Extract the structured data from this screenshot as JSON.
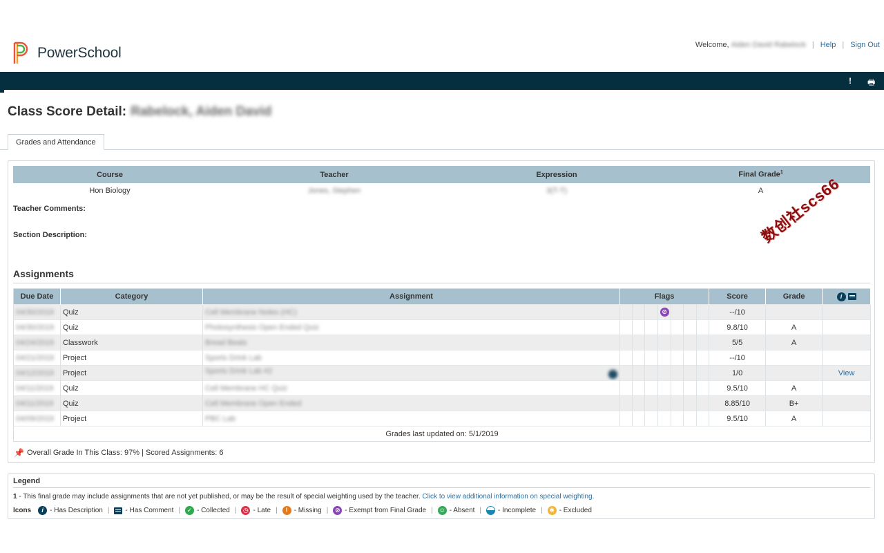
{
  "app": {
    "name": "PowerSchool"
  },
  "header": {
    "welcome_label": "Welcome,",
    "user_name": "Aiden David Rabelock",
    "help_label": "Help",
    "signout_label": "Sign Out",
    "alert_icon_glyph": "!",
    "print_icon_glyph": "🖶"
  },
  "page": {
    "title": "Class Score Detail:",
    "student_name": "Rabelock, Aiden David"
  },
  "tabs": [
    {
      "label": "Grades and Attendance"
    }
  ],
  "course": {
    "headers": {
      "course": "Course",
      "teacher": "Teacher",
      "expression": "Expression",
      "final_grade": "Final Grade",
      "final_grade_sup": "1"
    },
    "row": {
      "course": "Hon Biology",
      "teacher": "Jones, Stephen",
      "expression": "3(T-T)",
      "final_grade": "A"
    },
    "teacher_comments_label": "Teacher Comments:",
    "section_description_label": "Section Description:"
  },
  "watermark": "数创社scs66",
  "assignments": {
    "heading": "Assignments",
    "headers": {
      "due_date": "Due Date",
      "category": "Category",
      "assignment": "Assignment",
      "flags": "Flags",
      "score": "Score",
      "grade": "Grade"
    },
    "rows": [
      {
        "due_date": "04/30/2019",
        "category": "Quiz",
        "assignment": "Cell Membrane Notes (HC)",
        "score": "--/10",
        "grade": "",
        "action": ""
      },
      {
        "due_date": "04/30/2019",
        "category": "Quiz",
        "assignment": "Photosynthesis Open Ended Quiz",
        "score": "9.8/10",
        "grade": "A",
        "action": ""
      },
      {
        "due_date": "04/24/2019",
        "category": "Classwork",
        "assignment": "Bread Beats",
        "score": "5/5",
        "grade": "A",
        "action": ""
      },
      {
        "due_date": "04/21/2019",
        "category": "Project",
        "assignment": "Sports Drink Lab",
        "score": "--/10",
        "grade": "",
        "action": ""
      },
      {
        "due_date": "04/12/2019",
        "category": "Project",
        "assignment": "Sports Drink Lab #2",
        "score": "1/0",
        "grade": "",
        "action": "View"
      },
      {
        "due_date": "04/11/2019",
        "category": "Quiz",
        "assignment": "Cell Membrane HC Quiz",
        "score": "9.5/10",
        "grade": "A",
        "action": ""
      },
      {
        "due_date": "04/11/2019",
        "category": "Quiz",
        "assignment": "Cell Membrane Open Ended",
        "score": "8.85/10",
        "grade": "B+",
        "action": ""
      },
      {
        "due_date": "04/09/2019",
        "category": "Project",
        "assignment": "PBC Lab",
        "score": "9.5/10",
        "grade": "A",
        "action": ""
      }
    ],
    "footer": "Grades last updated on: 5/1/2019",
    "overall": "Overall Grade In This Class: 97% | Scored Assignments: 6"
  },
  "legend": {
    "title": "Legend",
    "note_num": "1",
    "note_text": " - This final grade may include assignments that are not yet published, or may be the result of special weighting used by the teacher. ",
    "note_link": "Click to view additional information on special weighting.",
    "icons_label": "Icons",
    "icons": {
      "description": "- Has Description",
      "comment": "- Has Comment",
      "collected": "- Collected",
      "late": "- Late",
      "missing": "- Missing",
      "exempt": "- Exempt from Final Grade",
      "absent": "- Absent",
      "incomplete": "- Incomplete",
      "excluded": "- Excluded"
    },
    "separator": "|"
  },
  "colors": {
    "navbar": "#052e3f",
    "table_header": "#a7c0cd",
    "link": "#2d6fa0",
    "watermark": "#8c0f0f"
  }
}
